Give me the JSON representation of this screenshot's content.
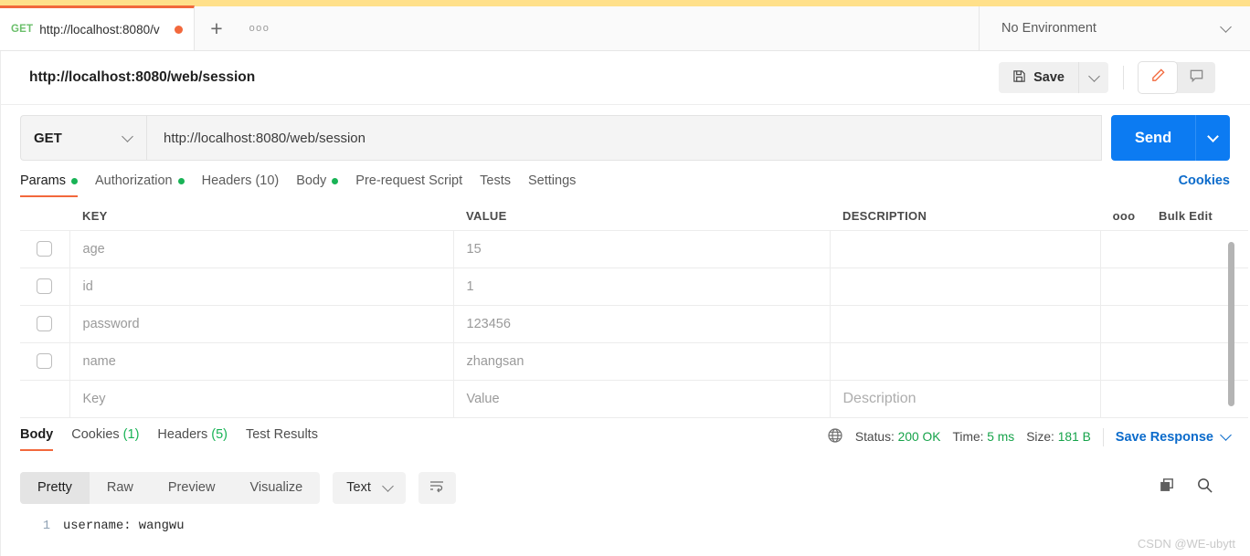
{
  "tabstrip": {
    "request_tab": {
      "method": "GET",
      "url": "http://localhost:8080/v",
      "unsaved_icon": "unsaved-dot"
    },
    "new_tab_icon": "plus-icon",
    "more_icon": "ellipsis-icon",
    "environment": {
      "label": "No Environment",
      "chevron_icon": "chevron-down-icon"
    }
  },
  "namebar": {
    "request_name": "http://localhost:8080/web/session",
    "save_label": "Save",
    "save_icon": "floppy-disk-icon",
    "save_caret_icon": "chevron-down-icon",
    "edit_icon": "pencil-icon",
    "comment_icon": "comment-icon"
  },
  "urlbar": {
    "method": "GET",
    "method_caret_icon": "chevron-down-icon",
    "url": "http://localhost:8080/web/session",
    "send_label": "Send",
    "send_caret_icon": "chevron-down-icon"
  },
  "request_tabs": [
    {
      "label": "Params",
      "dot": true,
      "active": true
    },
    {
      "label": "Authorization",
      "dot": true,
      "active": false
    },
    {
      "label": "Headers (10)",
      "dot": false,
      "active": false
    },
    {
      "label": "Body",
      "dot": true,
      "active": false
    },
    {
      "label": "Pre-request Script",
      "dot": false,
      "active": false
    },
    {
      "label": "Tests",
      "dot": false,
      "active": false
    },
    {
      "label": "Settings",
      "dot": false,
      "active": false
    }
  ],
  "cookies_link": "Cookies",
  "params_table": {
    "headers": {
      "key": "KEY",
      "value": "VALUE",
      "description": "DESCRIPTION",
      "more_icon": "ellipsis-icon",
      "bulk_edit": "Bulk Edit"
    },
    "rows": [
      {
        "checked": false,
        "key": "age",
        "value": "15",
        "description": ""
      },
      {
        "checked": false,
        "key": "id",
        "value": "1",
        "description": ""
      },
      {
        "checked": false,
        "key": "password",
        "value": "123456",
        "description": ""
      },
      {
        "checked": false,
        "key": "name",
        "value": "zhangsan",
        "description": ""
      }
    ],
    "placeholder_row": {
      "key": "Key",
      "value": "Value",
      "description": "Description"
    }
  },
  "response_tabs": [
    {
      "label": "Body",
      "count": "",
      "active": true
    },
    {
      "label": "Cookies",
      "count": "(1)",
      "active": false
    },
    {
      "label": "Headers",
      "count": "(5)",
      "active": false
    },
    {
      "label": "Test Results",
      "count": "",
      "active": false
    }
  ],
  "response_meta": {
    "globe_icon": "globe-icon",
    "status_label": "Status:",
    "status_value": "200 OK",
    "time_label": "Time:",
    "time_value": "5 ms",
    "size_label": "Size:",
    "size_value": "181 B",
    "save_response": "Save Response",
    "save_response_caret_icon": "chevron-down-icon"
  },
  "body_toolbar": {
    "views": [
      {
        "label": "Pretty",
        "active": true
      },
      {
        "label": "Raw",
        "active": false
      },
      {
        "label": "Preview",
        "active": false
      },
      {
        "label": "Visualize",
        "active": false
      }
    ],
    "format": "Text",
    "format_caret_icon": "chevron-down-icon",
    "wrap_icon": "word-wrap-icon",
    "copy_icon": "copy-icon",
    "search_icon": "search-icon"
  },
  "response_body": {
    "lines": [
      {
        "number": "1",
        "text": "username: wangwu"
      }
    ]
  },
  "watermark": "CSDN @WE-ubytt",
  "colors": {
    "accent_orange": "#f2683c",
    "send_blue": "#0c7bf2",
    "link_blue": "#0b6bcb",
    "success_green": "#19b356",
    "top_band_yellow": "#ffe08a"
  }
}
